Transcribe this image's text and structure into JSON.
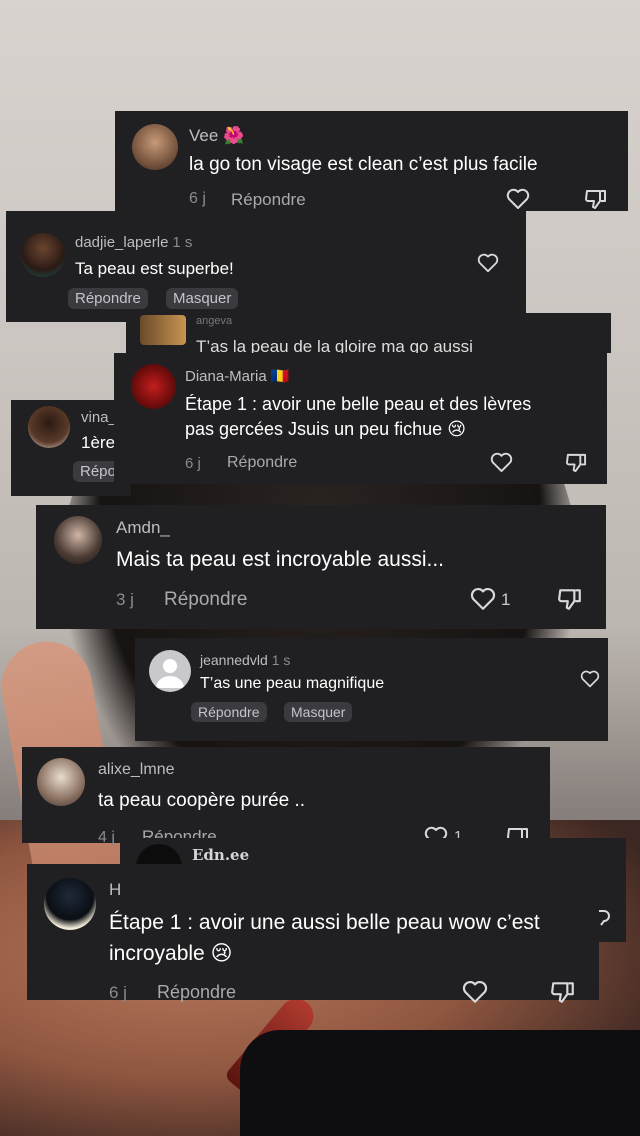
{
  "comments": [
    {
      "user": "Vee",
      "emoji": "🌺",
      "text": "la go ton visage est clean c’est plus facile",
      "date": "6 j",
      "reply": "Répondre"
    },
    {
      "user": "dadjie_laperle",
      "meta": "1 s",
      "text": "Ta peau est superbe!",
      "reply": "Répondre",
      "hide": "Masquer"
    },
    {
      "user": "Diana-Maria",
      "emoji": "🇷🇴",
      "text_line1": "Étape 1 : avoir une belle peau et des lèvres",
      "text_line2": "pas gercées Jsuis un peu fichue",
      "text_emoji": "😢",
      "date": "6 j",
      "reply": "Répondre"
    },
    {
      "user": "vina_",
      "text": "1ère",
      "reply": "Répondre"
    },
    {
      "user": "Amdn_",
      "text": "Mais ta peau est incroyable aussi...",
      "date": "3 j",
      "reply": "Répondre",
      "likes": "1"
    },
    {
      "user": "jeannedvld",
      "meta": "1 s",
      "text": "T’as une peau magnifique",
      "reply": "Répondre",
      "hide": "Masquer"
    },
    {
      "user": "alixe_lmne",
      "text": "ta peau coopère purée ..",
      "date": "4 j",
      "reply": "Répondre",
      "likes": "1"
    },
    {
      "user": "Edn.ee"
    },
    {
      "user": "H",
      "text_line1": "Étape 1 : avoir une aussi belle peau wow c’est",
      "text_line2": "incroyable",
      "text_emoji": "😢",
      "date": "6 j",
      "reply": "Répondre"
    }
  ],
  "partial": {
    "user": "angeva",
    "text": "T’as la peau de la gloire ma go aussi"
  },
  "colors": {
    "card": "#202023",
    "username": "#bdbdc2",
    "muted": "#8a8a90",
    "chip": "#3a3a3f"
  },
  "icons": [
    "heart-icon",
    "thumbs-down-icon"
  ]
}
